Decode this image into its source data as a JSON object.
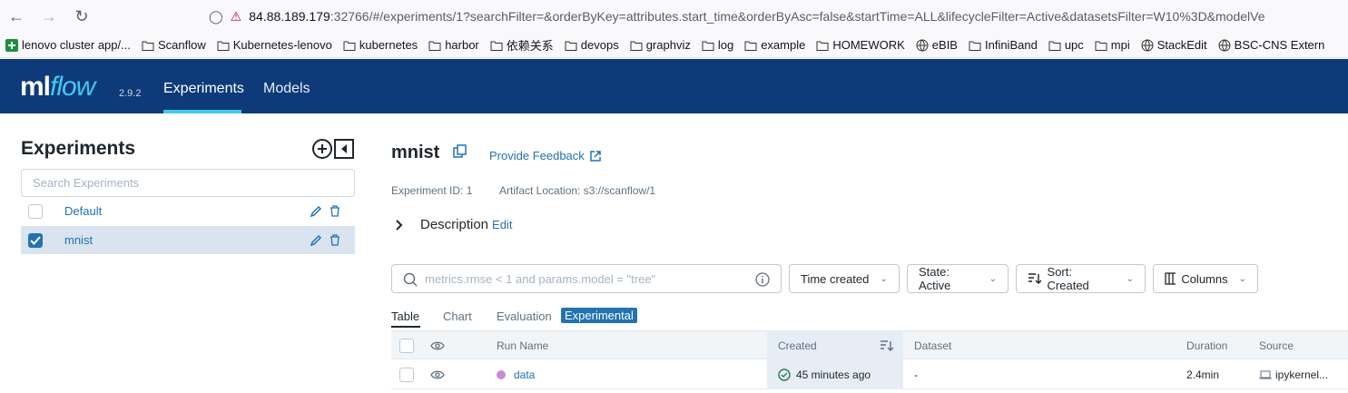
{
  "browser": {
    "url_host": "84.88.189.179",
    "url_rest": ":32766/#/experiments/1?searchFilter=&orderByKey=attributes.start_time&orderByAsc=false&startTime=ALL&lifecycleFilter=Active&datasetsFilter=W10%3D&modelVe",
    "bookmarks": [
      "lenovo cluster app/...",
      "Scanflow",
      "Kubernetes-lenovo",
      "kubernetes",
      "harbor",
      "依赖关系",
      "devops",
      "graphviz",
      "log",
      "example",
      "HOMEWORK",
      "eBIB",
      "InfiniBand",
      "upc",
      "mpi",
      "StackEdit",
      "BSC-CNS Extern"
    ]
  },
  "topnav": {
    "logo_ml": "ml",
    "logo_flow": "flow",
    "version": "2.9.2",
    "tabs": [
      "Experiments",
      "Models"
    ]
  },
  "sidebar": {
    "title": "Experiments",
    "search_placeholder": "Search Experiments",
    "experiments": [
      {
        "name": "Default",
        "checked": false
      },
      {
        "name": "mnist",
        "checked": true
      }
    ]
  },
  "main": {
    "title": "mnist",
    "feedback": "Provide Feedback",
    "experiment_id": "Experiment ID: 1",
    "artifact_location": "Artifact Location: s3://scanflow/1",
    "description": "Description",
    "edit": "Edit",
    "filter_placeholder": "metrics.rmse < 1 and params.model = \"tree\"",
    "time_created": "Time created",
    "state": "State: Active",
    "sort": "Sort: Created",
    "columns": "Columns",
    "subtabs": [
      "Table",
      "Chart",
      "Evaluation",
      "Experimental"
    ],
    "table": {
      "headers": [
        "Run Name",
        "Created",
        "Dataset",
        "Duration",
        "Source"
      ],
      "rows": [
        {
          "run_name": "data",
          "created": "45 minutes ago",
          "dataset": "-",
          "duration": "2.4min",
          "source": "ipykernel..."
        }
      ]
    }
  }
}
